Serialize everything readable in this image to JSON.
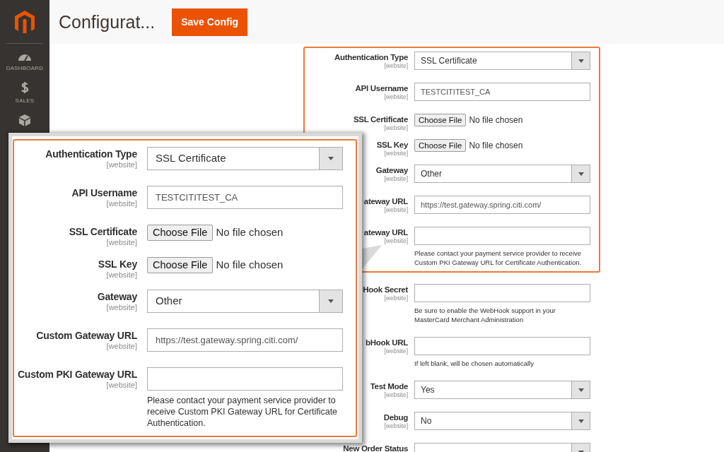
{
  "sidebar": {
    "items": [
      {
        "label": "DASHBOARD"
      },
      {
        "label": "SALES"
      }
    ]
  },
  "header": {
    "title": "Configurat...",
    "save_button": "Save Config"
  },
  "config_form": {
    "highlighted_rows": [
      {
        "kind": "select",
        "label": "Authentication Type",
        "scope": "[website]",
        "value": "SSL Certificate"
      },
      {
        "kind": "text",
        "label": "API Username",
        "scope": "[website]",
        "value": "TESTCITITEST_CA"
      },
      {
        "kind": "file",
        "label": "SSL Certificate",
        "scope": "[website]",
        "button": "Choose File",
        "status": "No file chosen"
      },
      {
        "kind": "file",
        "label": "SSL Key",
        "scope": "[website]",
        "button": "Choose File",
        "status": "No file chosen"
      },
      {
        "kind": "select",
        "label": "Gateway",
        "scope": "[website]",
        "value": "Other"
      },
      {
        "kind": "text",
        "label": "ateway URL",
        "scope": "[website]",
        "value": "https://test.gateway.spring.citi.com/"
      },
      {
        "kind": "text",
        "label": "ateway URL",
        "scope": "[website]",
        "note": "Please contact your payment service provider to receive Custom PKI Gateway URL for Certificate Authentication."
      }
    ],
    "rows": [
      {
        "kind": "text",
        "label": "Hook Secret",
        "scope": "[website]",
        "note": "Be sure to enable the WebHook support in your MasterCard Merchant Administration"
      },
      {
        "kind": "text",
        "label": "bHook URL",
        "scope": "[website]",
        "note": "If left blank, will be chosen automatically"
      },
      {
        "kind": "select",
        "label": "Test Mode",
        "scope": "[website]",
        "value": "Yes"
      },
      {
        "kind": "select",
        "label": "Debug",
        "scope": "[website]",
        "value": "No"
      },
      {
        "kind": "select",
        "label": "New Order Status"
      }
    ]
  },
  "zoom_callout": {
    "rows": [
      {
        "kind": "select",
        "label": "Authentication Type",
        "scope": "[website]",
        "value": "SSL Certificate"
      },
      {
        "kind": "text",
        "label": "API Username",
        "scope": "[website]",
        "value": "TESTCITITEST_CA"
      },
      {
        "kind": "file",
        "label": "SSL Certificate",
        "scope": "[website]",
        "button": "Choose File",
        "status": "No file chosen"
      },
      {
        "kind": "file",
        "label": "SSL Key",
        "scope": "[website]",
        "button": "Choose File",
        "status": "No file chosen"
      },
      {
        "kind": "select",
        "label": "Gateway",
        "scope": "[website]",
        "value": "Other"
      },
      {
        "kind": "text",
        "label": "Custom Gateway URL",
        "scope": "[website]",
        "value": "https://test.gateway.spring.citi.com/"
      },
      {
        "kind": "text",
        "label": "Custom PKI Gateway URL",
        "scope": "[website]",
        "note": "Please contact your payment service provider to receive Custom PKI Gateway URL for Certificate Authentication."
      }
    ]
  }
}
